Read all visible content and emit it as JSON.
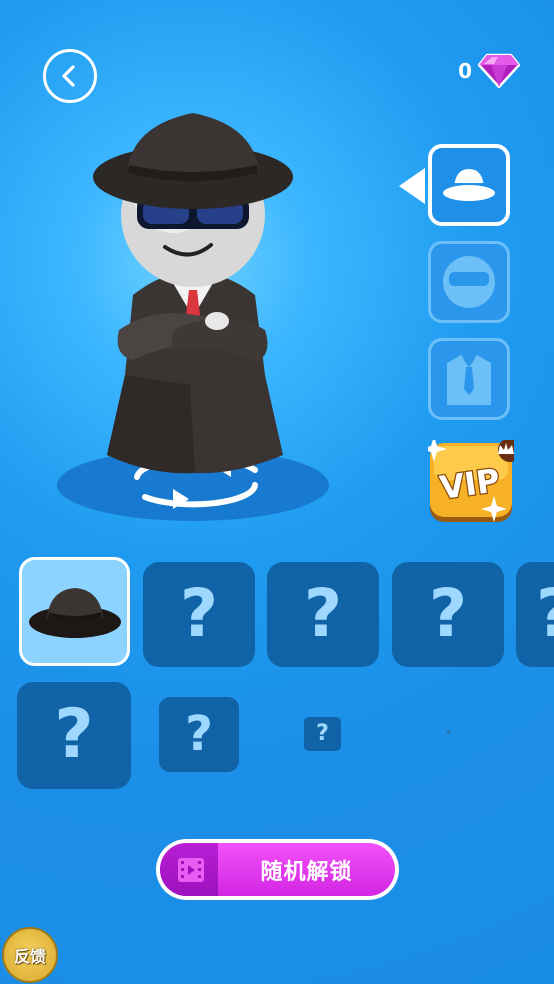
{
  "header": {
    "back_icon": "chevron-left-icon",
    "gem_count": "0",
    "gem_icon": "purple-gem-icon"
  },
  "categories": [
    {
      "name": "hat",
      "icon": "hat-icon",
      "selected": true
    },
    {
      "name": "glasses",
      "icon": "face-glasses-icon",
      "selected": false
    },
    {
      "name": "suit",
      "icon": "suit-tie-icon",
      "selected": false
    }
  ],
  "vip": {
    "label": "VIP"
  },
  "grid": {
    "slots": [
      {
        "state": "selected",
        "item": "black-fedora-hat"
      },
      {
        "state": "locked",
        "label": "?"
      },
      {
        "state": "locked",
        "label": "?"
      },
      {
        "state": "locked",
        "label": "?"
      },
      {
        "state": "locked",
        "label": "?"
      },
      {
        "state": "locked",
        "label": "?"
      },
      {
        "state": "locked",
        "label": "?"
      },
      {
        "state": "locked",
        "label": "?"
      }
    ]
  },
  "unlock_button": {
    "label": "随机解锁",
    "icon": "film-video-icon"
  },
  "feedback": {
    "label": "反馈"
  },
  "colors": {
    "background": "#1e9bf0",
    "slot": "#0f63a6",
    "selected_slot": "#8cd3ff",
    "unlock_pink": "#e43cf0",
    "vip_gold": "#f5a623"
  }
}
